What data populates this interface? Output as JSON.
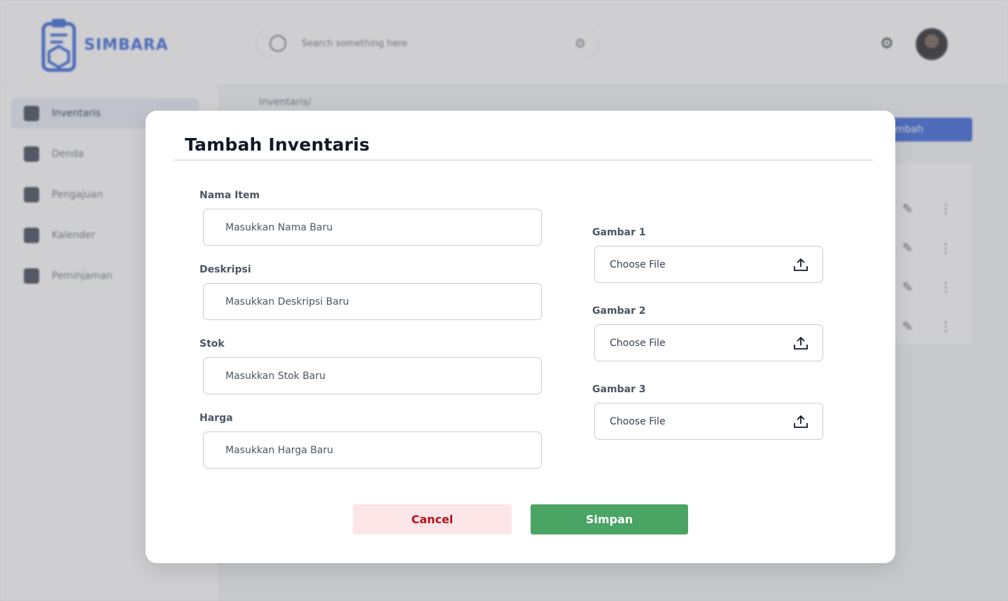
{
  "app": {
    "brand": "SIMBARA",
    "search_placeholder": "Search something here",
    "breadcrumb": "Inventaris/",
    "add_button": "Tambah",
    "sidebar": [
      {
        "label": "Inventaris",
        "icon": "grid-icon",
        "active": true
      },
      {
        "label": "Denda",
        "icon": "document-icon",
        "active": false
      },
      {
        "label": "Pengajuan",
        "icon": "edit-icon",
        "active": false
      },
      {
        "label": "Kalender",
        "icon": "calendar-icon",
        "active": false
      },
      {
        "label": "Peminjaman",
        "icon": "file-icon",
        "active": false
      }
    ],
    "brand_color": "#2f5fd8"
  },
  "modal": {
    "title": "Tambah Inventaris",
    "fields": [
      {
        "label": "Nama Item",
        "placeholder": "Masukkan Nama Baru"
      },
      {
        "label": "Deskripsi",
        "placeholder": "Masukkan Deskripsi Baru"
      },
      {
        "label": "Stok",
        "placeholder": "Masukkan Stok Baru"
      },
      {
        "label": "Harga",
        "placeholder": "Masukkan Harga Baru"
      }
    ],
    "images": [
      {
        "label": "Gambar 1",
        "button": "Choose File",
        "icon": "upload-icon"
      },
      {
        "label": "Gambar 2",
        "button": "Choose File",
        "icon": "upload-icon"
      },
      {
        "label": "Gambar 3",
        "button": "Choose File",
        "icon": "upload-icon"
      }
    ],
    "cancel_label": "Cancel",
    "save_label": "Simpan",
    "cancel_color": "#b3121b",
    "save_color": "#4aa565"
  }
}
